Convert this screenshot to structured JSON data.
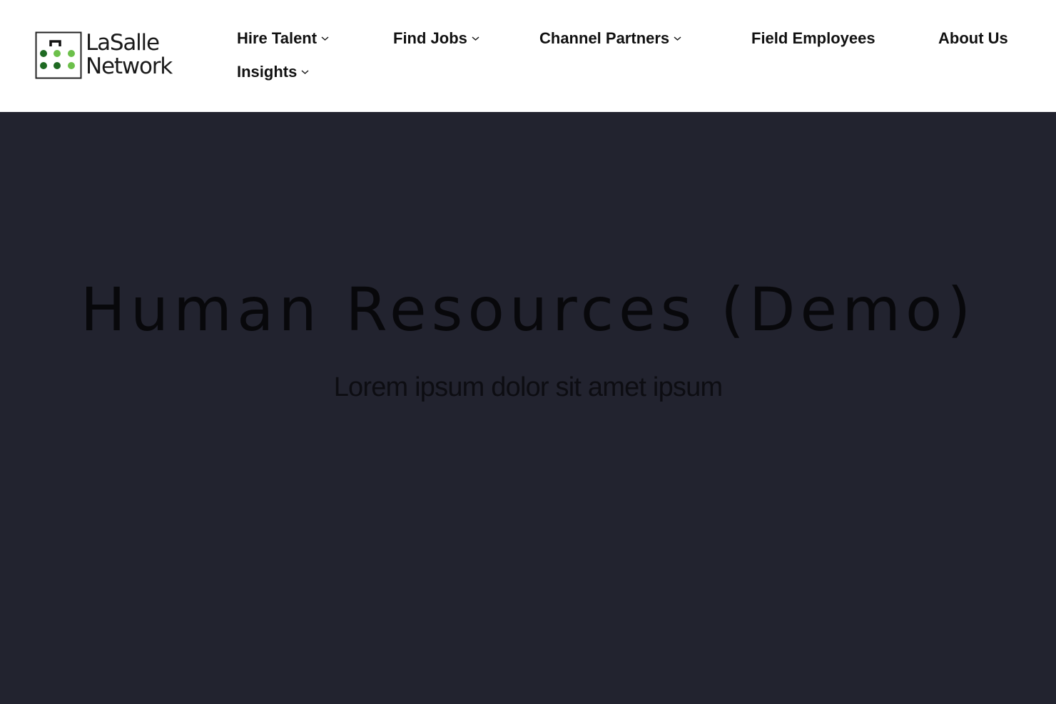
{
  "header": {
    "logo": {
      "line1": "LaSalle",
      "line2": "Network",
      "dot_colors": [
        "#1e6a22",
        "#6cc04a"
      ]
    },
    "nav": [
      {
        "label": "Hire Talent",
        "dropdown": true
      },
      {
        "label": "Find Jobs",
        "dropdown": true
      },
      {
        "label": "Channel Partners",
        "dropdown": true
      },
      {
        "label": "Field Employees",
        "dropdown": false
      },
      {
        "label": "About Us",
        "dropdown": false
      },
      {
        "label": "Insights",
        "dropdown": true
      }
    ]
  },
  "hero": {
    "title": "Human Resources (Demo)",
    "subtitle": "Lorem ipsum dolor sit amet ipsum",
    "background_color": "#22232f"
  }
}
